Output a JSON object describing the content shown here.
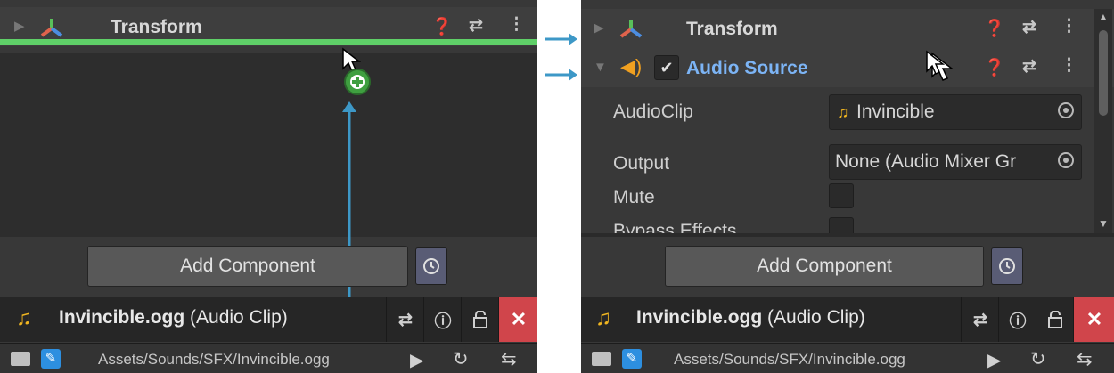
{
  "left": {
    "component": {
      "title": "Transform"
    },
    "add_component_label": "Add Component",
    "asset": {
      "name": "Invincible.ogg",
      "type": "(Audio Clip)"
    },
    "path": "Assets/Sounds/SFX/Invincible.ogg"
  },
  "right": {
    "transform": {
      "title": "Transform"
    },
    "audio_source": {
      "title": "Audio Source",
      "enabled": true,
      "properties": [
        {
          "label": "AudioClip",
          "value": "Invincible"
        },
        {
          "label": "Output",
          "value": "None (Audio Mixer Gr"
        },
        {
          "label": "Mute"
        },
        {
          "label": "Bypass Effects"
        }
      ]
    },
    "add_component_label": "Add Component",
    "asset": {
      "name": "Invincible.ogg",
      "type": "(Audio Clip)"
    },
    "path": "Assets/Sounds/SFX/Invincible.ogg"
  },
  "colors": {
    "panel_bg": "#383838",
    "drop_line": "#5fd068",
    "accent_blue": "#3d98c7",
    "audio_title": "#7cb4f5",
    "close_red": "#d0454b"
  },
  "icons": [
    "transform-icon",
    "help-icon",
    "presets-icon",
    "more-icon",
    "add-plus-icon",
    "audio-source-icon",
    "music-note-icon",
    "info-icon",
    "lock-icon",
    "close-icon",
    "folder-icon",
    "script-icon",
    "play-icon",
    "autoplay-icon",
    "loop-icon",
    "preset-history-icon",
    "object-target-icon",
    "mouse-cursor-icon"
  ]
}
